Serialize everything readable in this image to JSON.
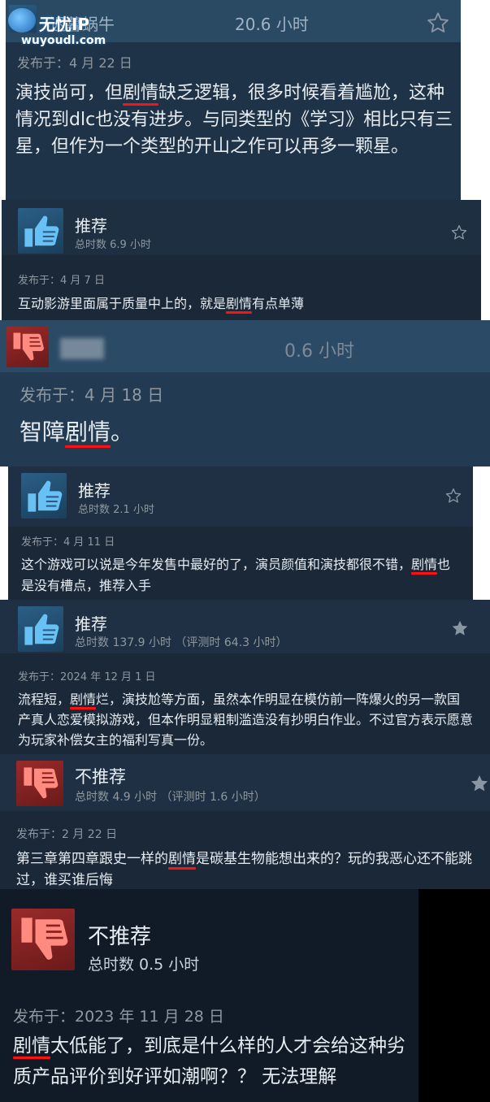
{
  "watermark": {
    "line1": "无忧IP",
    "line2": "wuyoudl.com"
  },
  "reviews": [
    {
      "recommend": true,
      "title": "迟暮蜗牛",
      "hours": "20.6 小时",
      "date": "发布于：4 月 22 日",
      "body": [
        {
          "t": "演技尚可，但"
        },
        {
          "t": "剧情",
          "hl": true
        },
        {
          "t": "缺乏逻辑，很多时候看着尴尬，这种情况到dlc也没有进步。与同类型的《学习》相比只有三星，但作为一个类型的开山之作可以再多一颗星。"
        }
      ]
    },
    {
      "recommend": true,
      "title": "推荐",
      "hours": "总时数 6.9 小时",
      "date": "发布于：4 月 7 日",
      "body": [
        {
          "t": "互动影游里面属于质量中上的，就是"
        },
        {
          "t": "剧情",
          "hl": true
        },
        {
          "t": "有点单薄"
        }
      ]
    },
    {
      "recommend": false,
      "title": "",
      "hours": "0.6 小时",
      "date": "发布于：4 月 18 日",
      "body": [
        {
          "t": "智障"
        },
        {
          "t": "剧情",
          "hl": true
        },
        {
          "t": "。"
        }
      ]
    },
    {
      "recommend": true,
      "title": "推荐",
      "hours": "总时数 2.1 小时",
      "date": "发布于：4 月 11 日",
      "body": [
        {
          "t": "这个游戏可以说是今年发售中最好的了，演员颜值和演技都很不错，"
        },
        {
          "t": "剧情",
          "hl": true
        },
        {
          "t": "也是没有槽点，推荐入手"
        }
      ]
    },
    {
      "recommend": true,
      "title": "推荐",
      "hours": "总时数 137.9 小时 （评测时 64.3 小时）",
      "date": "发布于：2024 年 12 月 1 日",
      "body": [
        {
          "t": "流程短，"
        },
        {
          "t": "剧情",
          "hl": true
        },
        {
          "t": "烂，演技尬等方面，虽然本作明显在模仿前一阵爆火的另一款国产真人恋爱模拟游戏，但本作明显粗制滥造没有抄明白作业。不过官方表示愿意为玩家补偿女主的福利写真一份。"
        }
      ]
    },
    {
      "recommend": false,
      "title": "不推荐",
      "hours": "总时数 4.9 小时 （评测时 1.6 小时）",
      "date": "发布于：2 月 22 日",
      "body": [
        {
          "t": "第三章第四章跟史一样的"
        },
        {
          "t": "剧情",
          "hl": true
        },
        {
          "t": "是碳基生物能想出来的？玩的我恶心还不能跳过，谁买谁后悔"
        }
      ]
    },
    {
      "recommend": false,
      "title": "不推荐",
      "hours": "总时数 0.5 小时",
      "date": "发布于：2023 年 11 月 28 日",
      "body": [
        {
          "t": "剧情",
          "hl": true
        },
        {
          "t": "太低能了，到底是什么样的人才会给这种劣质产品评价到好评如潮啊？？ 无法理解"
        }
      ]
    }
  ]
}
